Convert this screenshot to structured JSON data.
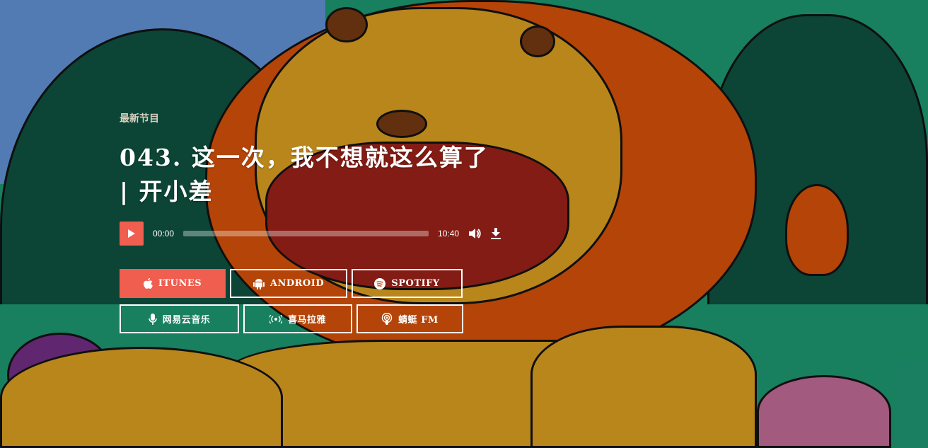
{
  "episode": {
    "kicker": "最新节目",
    "title": "043. 这一次，我不想就这么算了 | 开小差"
  },
  "player": {
    "current_time": "00:00",
    "duration": "10:40",
    "progress": 0
  },
  "platforms": [
    {
      "label": "ITUNES",
      "icon": "apple-icon"
    },
    {
      "label": "ANDROID",
      "icon": "android-icon"
    },
    {
      "label": "SPOTIFY",
      "icon": "spotify-icon"
    },
    {
      "label": "网易云音乐",
      "icon": "microphone-icon"
    },
    {
      "label": "喜马拉雅",
      "icon": "broadcast-icon"
    },
    {
      "label": "蜻蜓 FM",
      "icon": "podcast-icon"
    }
  ],
  "colors": {
    "accent": "#ef5e4f"
  }
}
